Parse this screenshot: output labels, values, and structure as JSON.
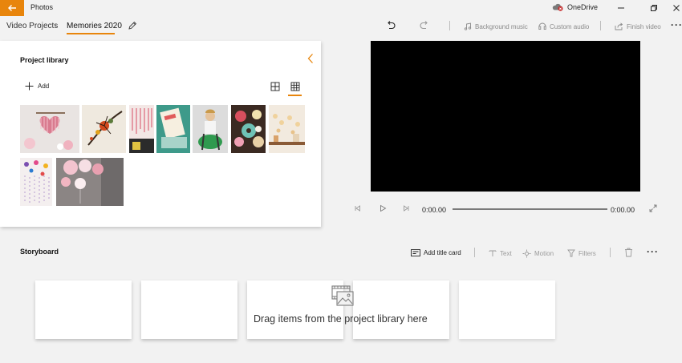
{
  "titlebar": {
    "app_title": "Photos",
    "onedrive_label": "OneDrive",
    "back_icon": "arrow-left-icon",
    "accent": "#e8850c"
  },
  "breadcrumb": {
    "root": "Video Projects",
    "current": "Memories 2020"
  },
  "toolbar": {
    "background_music": "Background music",
    "custom_audio": "Custom audio",
    "finish_video": "Finish video"
  },
  "library": {
    "title": "Project library",
    "add_label": "Add",
    "view_modes": [
      "small-grid",
      "large-grid"
    ],
    "selected_view": "large-grid",
    "thumbnails": [
      "heart-wall-art",
      "paint-splash-bird",
      "pink-tassels",
      "love-book-on-teal",
      "woman-in-green-chair",
      "donuts-and-flowers",
      "fairy-lights-on-shelf",
      "confetti-string-lights",
      "pink-paper-lanterns"
    ]
  },
  "player": {
    "current_time": "0:00.00",
    "total_time": "0:00.00",
    "progress": 0
  },
  "storyboard": {
    "title": "Storyboard",
    "add_title_card": "Add title card",
    "text": "Text",
    "motion": "Motion",
    "filters": "Filters",
    "drop_hint": "Drag items from the project library here",
    "slot_count": 5
  }
}
